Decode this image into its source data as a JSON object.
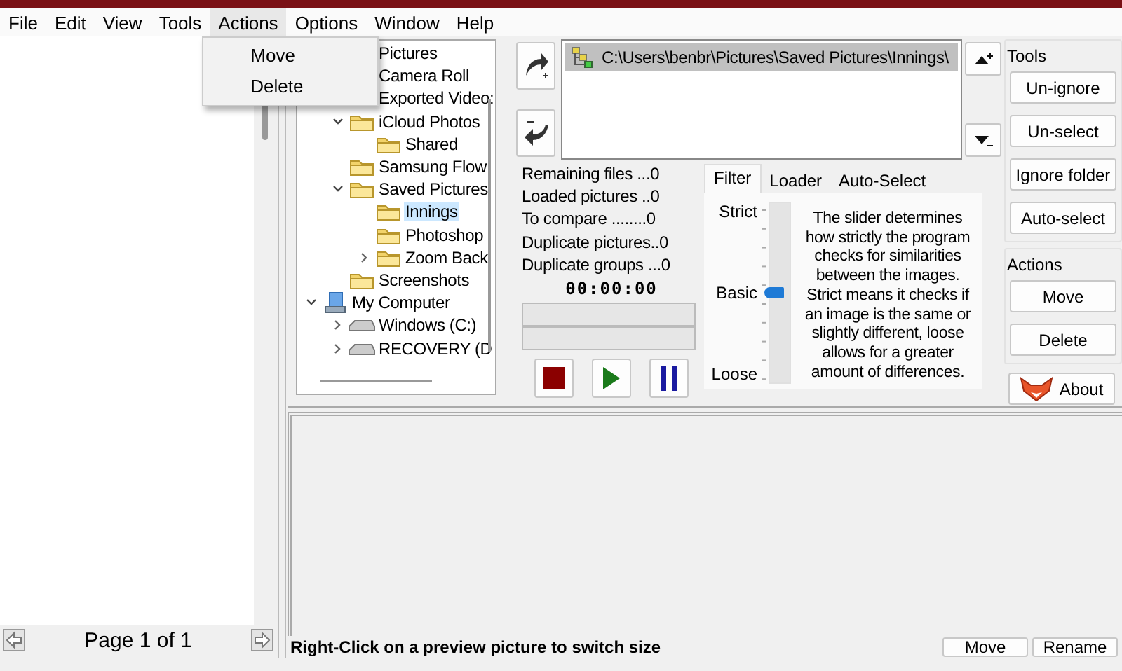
{
  "menu": {
    "items": [
      {
        "label": "File",
        "open": false
      },
      {
        "label": "Edit",
        "open": false
      },
      {
        "label": "View",
        "open": false
      },
      {
        "label": "Tools",
        "open": false
      },
      {
        "label": "Actions",
        "open": true
      },
      {
        "label": "Options",
        "open": false
      },
      {
        "label": "Window",
        "open": false
      },
      {
        "label": "Help",
        "open": false
      }
    ],
    "dropdown": [
      "Move",
      "Delete"
    ]
  },
  "left_panel": {
    "page_label": "Page 1 of 1"
  },
  "tree": {
    "items": [
      {
        "label": "Pictures",
        "selected": false
      },
      {
        "label": "Camera Roll",
        "selected": false
      },
      {
        "label": "Exported Video:",
        "selected": false
      },
      {
        "label": "iCloud Photos",
        "kind": "folder",
        "selected": false,
        "expanded": true,
        "children": [
          {
            "label": "Shared",
            "kind": "folder",
            "selected": false
          }
        ]
      },
      {
        "label": "Samsung Flow",
        "kind": "folder",
        "selected": false
      },
      {
        "label": "Saved Pictures",
        "kind": "folder",
        "selected": false,
        "expanded": true,
        "children": [
          {
            "label": "Innings",
            "kind": "folder",
            "selected": true
          },
          {
            "label": "Photoshop",
            "kind": "folder",
            "selected": false
          },
          {
            "label": "Zoom Back",
            "kind": "folder",
            "selected": false,
            "expanded": false
          }
        ]
      },
      {
        "label": "Screenshots",
        "kind": "folder",
        "selected": false
      },
      {
        "label": "My Computer",
        "kind": "computer",
        "selected": false,
        "expanded": true,
        "children": [
          {
            "label": "Windows (C:)",
            "kind": "drive",
            "selected": false,
            "expanded": false
          },
          {
            "label": "RECOVERY (D",
            "kind": "drive",
            "selected": false,
            "expanded": false
          }
        ]
      }
    ]
  },
  "folders": {
    "items": [
      {
        "path": "C:\\Users\\benbr\\Pictures\\Saved Pictures\\Innings\\",
        "selected": true
      }
    ]
  },
  "stats": [
    "Remaining files ...0",
    "Loaded pictures ..0",
    "To compare ........0",
    "Duplicate pictures..0",
    "Duplicate groups ...0"
  ],
  "timer": "00:00:00",
  "progress": [
    {
      "level": 0
    },
    {
      "level": 0
    }
  ],
  "filter_tabs": [
    {
      "label": "Filter",
      "selected": true
    },
    {
      "label": "Loader",
      "selected": false
    },
    {
      "label": "Auto-Select",
      "selected": false
    }
  ],
  "filter": {
    "scale": [
      "Strict",
      "Basic",
      "Loose"
    ],
    "level": 0.5,
    "description": "The slider determines how strictly the program checks for similarities between the images. Strict means it checks if an image is the same or slightly different, loose allows for a greater amount of differences."
  },
  "tools": {
    "title": "Tools",
    "buttons": [
      "Un-ignore",
      "Un-select",
      "Ignore folder",
      "Auto-select"
    ]
  },
  "actions": {
    "title": "Actions",
    "buttons": [
      "Move",
      "Delete"
    ]
  },
  "about_button": "About",
  "status_bar": {
    "hint": "Right-Click on a preview picture to switch size",
    "buttons": [
      "Move",
      "Rename"
    ]
  }
}
